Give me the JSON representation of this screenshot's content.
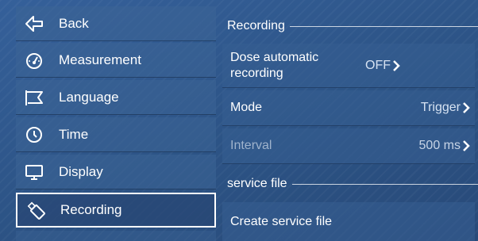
{
  "menu": {
    "items": [
      {
        "label": "Back",
        "icon": "back-arrow-icon"
      },
      {
        "label": "Measurement",
        "icon": "gauge-icon"
      },
      {
        "label": "Language",
        "icon": "flag-icon"
      },
      {
        "label": "Time",
        "icon": "clock-icon"
      },
      {
        "label": "Display",
        "icon": "monitor-icon"
      },
      {
        "label": "Recording",
        "icon": "usb-icon",
        "active": true
      }
    ]
  },
  "sections": {
    "recording": {
      "title": "Recording",
      "rows": [
        {
          "label": "Dose automatic recording",
          "value": "OFF"
        },
        {
          "label": "Mode",
          "value": "Trigger"
        },
        {
          "label": "Interval",
          "value": "500 ms",
          "disabled": true
        }
      ]
    },
    "service": {
      "title": "service file",
      "rows": [
        {
          "label": "Create service file",
          "value": ""
        }
      ]
    }
  },
  "colors": {
    "background": "#2f5687",
    "text": "#ffffff",
    "disabled_text": "#9fb3cc",
    "active_border": "#ffffff"
  }
}
